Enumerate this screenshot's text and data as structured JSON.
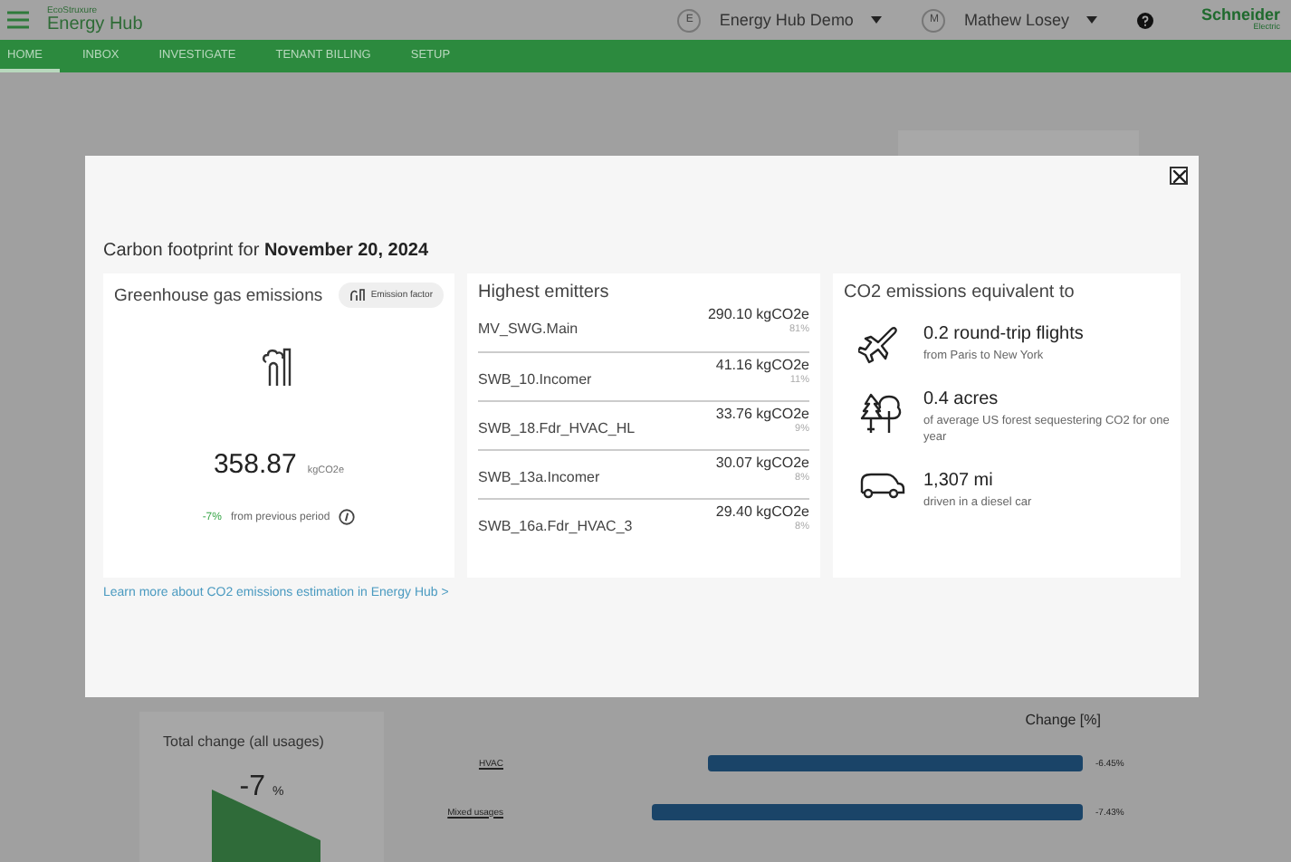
{
  "header": {
    "brand_small": "EcoStruxure",
    "brand": "Energy Hub",
    "site_initial": "E",
    "site": "Energy Hub Demo",
    "user_initial": "M",
    "user": "Mathew Losey",
    "logo": "Schneider",
    "logo_sub": "Electric"
  },
  "tabs": [
    {
      "label": "HOME",
      "selected": true
    },
    {
      "label": "INBOX",
      "selected": false
    },
    {
      "label": "INVESTIGATE",
      "selected": false
    },
    {
      "label": "TENANT BILLING",
      "selected": false
    },
    {
      "label": "SETUP",
      "selected": false
    }
  ],
  "total_change": {
    "title": "Total change (all usages)",
    "value": "-7",
    "unit": "%"
  },
  "change_chart": {
    "chart_data": {
      "type": "bar",
      "orientation": "horizontal",
      "title": "Change [%]",
      "categories": [
        "HVAC",
        "Mixed usages"
      ],
      "values": [
        -6.45,
        -7.43
      ],
      "value_labels": [
        "-6.45%",
        "-7.43%"
      ]
    }
  },
  "modal": {
    "title_prefix": "Carbon footprint for",
    "title_date": "November 20, 2024",
    "ghg": {
      "title": "Greenhouse gas emissions",
      "factor_button": "Emission factor",
      "value": "358.87",
      "unit": "kgCO2e",
      "change": "-7%",
      "change_text": "from previous period"
    },
    "emitters": {
      "title": "Highest emitters",
      "rows": [
        {
          "name": "MV_SWG.Main",
          "value": "290.10 kgCO2e",
          "share": "81%"
        },
        {
          "name": "SWB_10.Incomer",
          "value": "41.16 kgCO2e",
          "share": "11%"
        },
        {
          "name": "SWB_18.Fdr_HVAC_HL",
          "value": "33.76 kgCO2e",
          "share": "9%"
        },
        {
          "name": "SWB_13a.Incomer",
          "value": "30.07 kgCO2e",
          "share": "8%"
        },
        {
          "name": "SWB_16a.Fdr_HVAC_3",
          "value": "29.40 kgCO2e",
          "share": "8%"
        }
      ]
    },
    "equivalents": {
      "title": "CO2 emissions equivalent to",
      "items": [
        {
          "kind": "flight",
          "value": "0.2 round-trip flights",
          "detail": "from Paris to New York"
        },
        {
          "kind": "forest",
          "value": "0.4 acres",
          "detail": "of average US forest sequestering CO2 for one year"
        },
        {
          "kind": "car",
          "value": "1,307 mi",
          "detail": "driven in a diesel car"
        }
      ]
    },
    "link": "Learn more about CO2 emissions estimation in Energy Hub >"
  }
}
